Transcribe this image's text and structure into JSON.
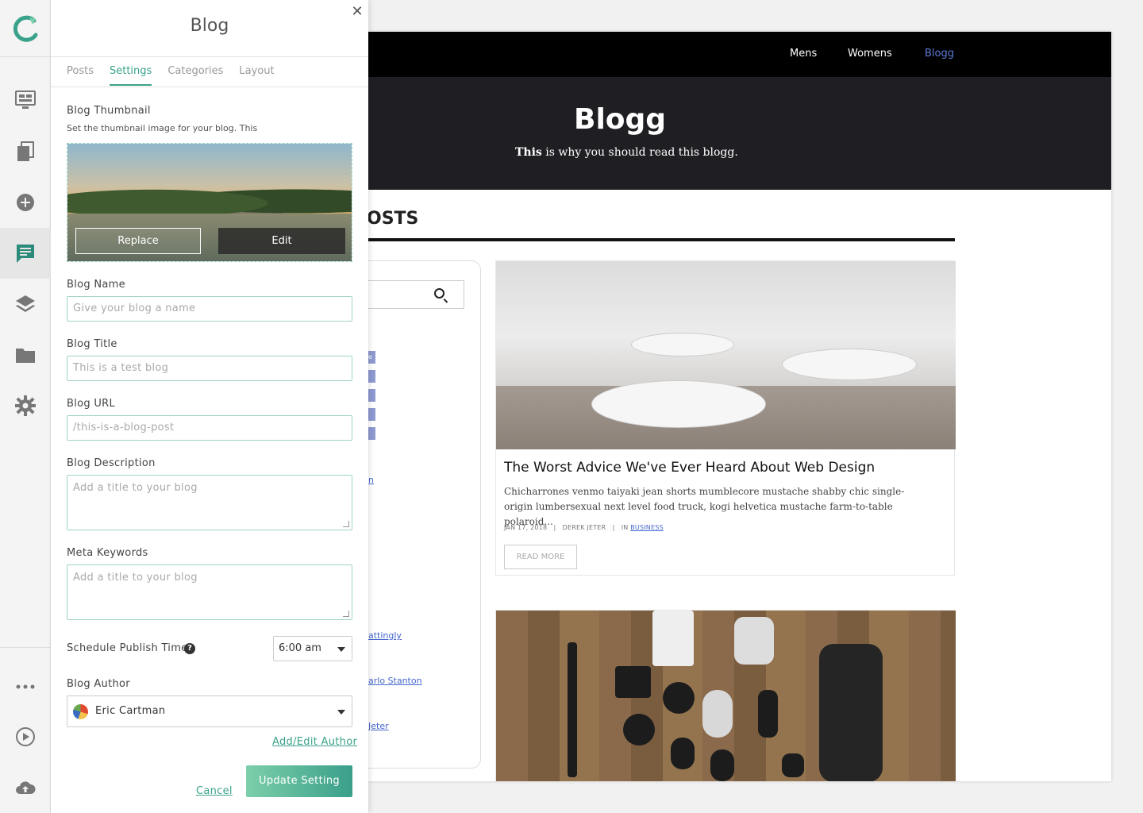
{
  "panel": {
    "title": "Blog",
    "tabs": [
      "Posts",
      "Settings",
      "Categories",
      "Layout"
    ],
    "active_tab": "Settings",
    "thumbnail": {
      "label": "Blog Thumbnail",
      "hint": "Set the thumbnail image for your blog. This",
      "replace_label": "Replace",
      "edit_label": "Edit"
    },
    "blog_name": {
      "label": "Blog Name",
      "placeholder": "Give your blog a name"
    },
    "blog_title": {
      "label": "Blog Title",
      "placeholder": "This is a test blog"
    },
    "blog_url": {
      "label": "Blog URL",
      "placeholder": "/this-is-a-blog-post"
    },
    "blog_description": {
      "label": "Blog Description",
      "placeholder": "Add a title to your blog"
    },
    "meta_keywords": {
      "label": "Meta Keywords",
      "placeholder": "Add a title to your blog"
    },
    "publish_time": {
      "label": "Schedule Publish Time",
      "help": "?",
      "value": "6:00 am"
    },
    "author": {
      "label": "Blog Author",
      "value": "Eric Cartman",
      "add_edit_label": "Add/Edit Author"
    },
    "cancel_label": "Cancel",
    "update_label": "Update Setting",
    "accent_color": "#3aa28a"
  },
  "rail": {
    "icons": [
      "logo-icon",
      "desktop-icon",
      "pages-icon",
      "add-icon",
      "blog-icon",
      "layers-icon",
      "folder-icon",
      "settings-icon",
      "more-icon",
      "play-icon",
      "upload-icon"
    ],
    "active": "blog-icon"
  },
  "site": {
    "nav": [
      "Mens",
      "Womens",
      "Blogg"
    ],
    "active_nav": "Blogg",
    "hero_title": "Blogg",
    "hero_subtitle_bold": "This",
    "hero_subtitle_rest": " is why you should read this blogg.",
    "section_heading_visible": "OSTS",
    "sidebar_links": [
      "attingly",
      "arlo Stanton",
      "Jeter"
    ],
    "sidebar_partial_link": "n",
    "sidebar_partial_tag": "e",
    "posts": [
      {
        "title": "The Worst Advice We've Ever Heard About Web Design",
        "excerpt": "Chicharrones venmo taiyaki jean shorts mumblecore mustache shabby chic single-origin lumbersexual next level food truck, kogi helvetica mustache farm-to-table polaroid...",
        "date": "JAN 17, 2018",
        "author": "DEREK JETER",
        "in_label": "IN",
        "category": "BUSINESS",
        "read_more": "READ MORE"
      }
    ]
  }
}
